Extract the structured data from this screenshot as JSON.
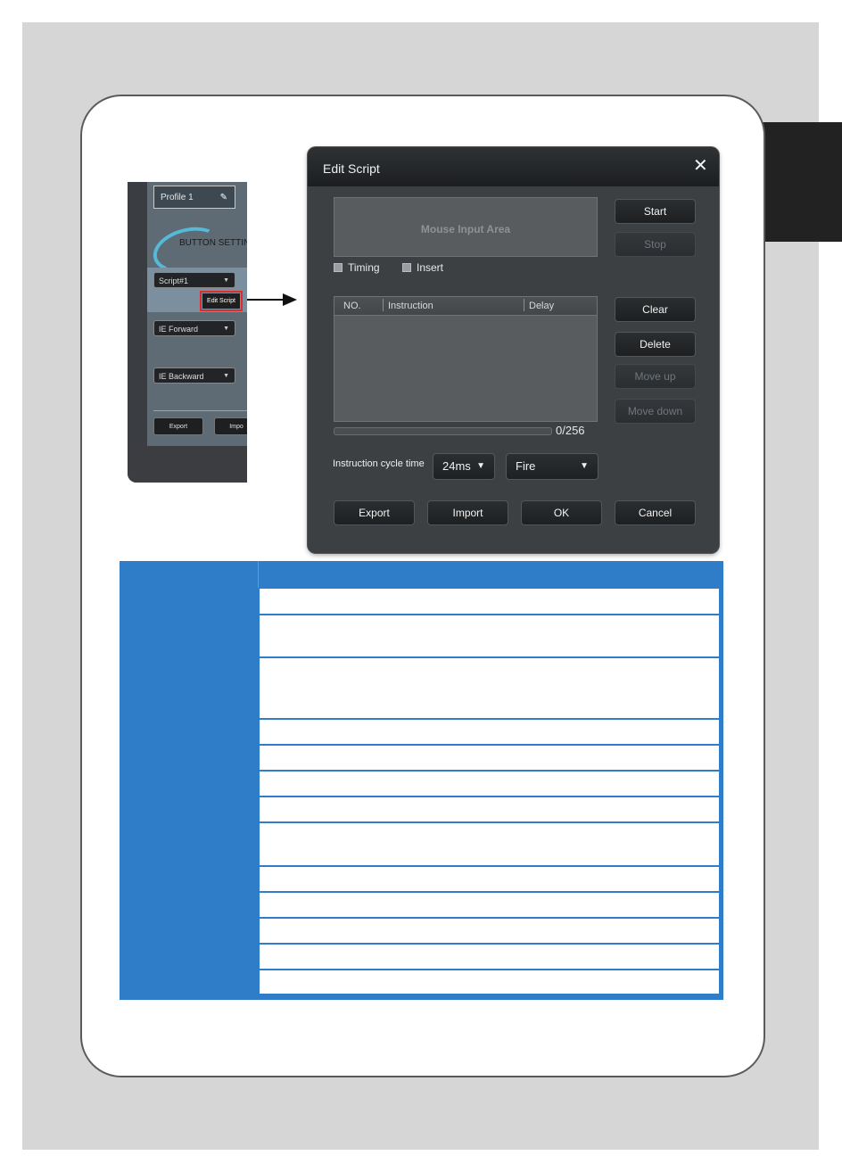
{
  "mini_screenshot": {
    "profile_label": "Profile 1",
    "section_title": "BUTTON SETTIN",
    "fields": [
      "Script#1",
      "IE Forward",
      "IE Backward"
    ],
    "edit_script_label": "Edit Script",
    "export_label": "Export",
    "import_label": "Impo"
  },
  "dialog": {
    "title": "Edit Script",
    "close_glyph": "✕",
    "mouse_input_area": "Mouse Input Area",
    "checkboxes": {
      "timing": "Timing",
      "insert": "Insert"
    },
    "buttons": {
      "start": "Start",
      "stop": "Stop",
      "clear": "Clear",
      "delete": "Delete",
      "move_up": "Move up",
      "move_down": "Move down",
      "export": "Export",
      "import": "Import",
      "ok": "OK",
      "cancel": "Cancel"
    },
    "list_columns": [
      "NO.",
      "Instruction",
      "Delay"
    ],
    "counter": "0/256",
    "cycle_label": "Instruction cycle time",
    "cycle_value": "24ms",
    "mode_value": "Fire"
  },
  "table": {
    "row_count": 15
  }
}
